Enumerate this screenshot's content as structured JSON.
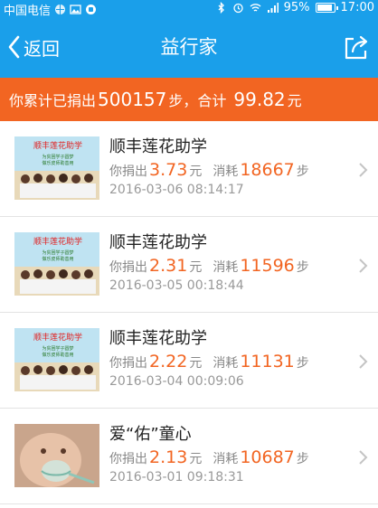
{
  "status_bar": {
    "carrier": "中国电信",
    "battery_text": "95%",
    "battery_level": 0.95,
    "time": "17:00"
  },
  "nav": {
    "back_label": "返回",
    "title": "益行家"
  },
  "summary": {
    "prefix": "你累计已捐出",
    "steps": "500157",
    "steps_unit": "步，合计",
    "amount": "99.82",
    "amount_unit": "元"
  },
  "labels": {
    "donated": "你捐出",
    "yuan": "元",
    "consumed": "消耗",
    "steps": "步"
  },
  "donations": [
    {
      "title": "顺丰莲花助学",
      "amount": "3.73",
      "steps": "18667",
      "date": "2016-03-06 08:14:17",
      "banner_title": "顺丰莲花助学",
      "banner_sub1": "为贫困学子圆梦",
      "banner_sub2": "做乐皮师助善用"
    },
    {
      "title": "顺丰莲花助学",
      "amount": "2.31",
      "steps": "11596",
      "date": "2016-03-05 00:18:44",
      "banner_title": "顺丰莲花助学",
      "banner_sub1": "为贫困学子圆梦",
      "banner_sub2": "做乐皮师助善用"
    },
    {
      "title": "顺丰莲花助学",
      "amount": "2.22",
      "steps": "11131",
      "date": "2016-03-04 00:09:06",
      "banner_title": "顺丰莲花助学",
      "banner_sub1": "为贫困学子圆梦",
      "banner_sub2": "做乐皮师助善用"
    },
    {
      "title": "爱“佑”童心",
      "amount": "2.13",
      "steps": "10687",
      "date": "2016-03-01 09:18:31"
    }
  ],
  "colors": {
    "header": "#1a9fea",
    "banner": "#f26522",
    "accent": "#f26522"
  },
  "icons": {
    "back": "chevron-left-icon",
    "share": "share-icon",
    "row": "chevron-right-icon"
  }
}
